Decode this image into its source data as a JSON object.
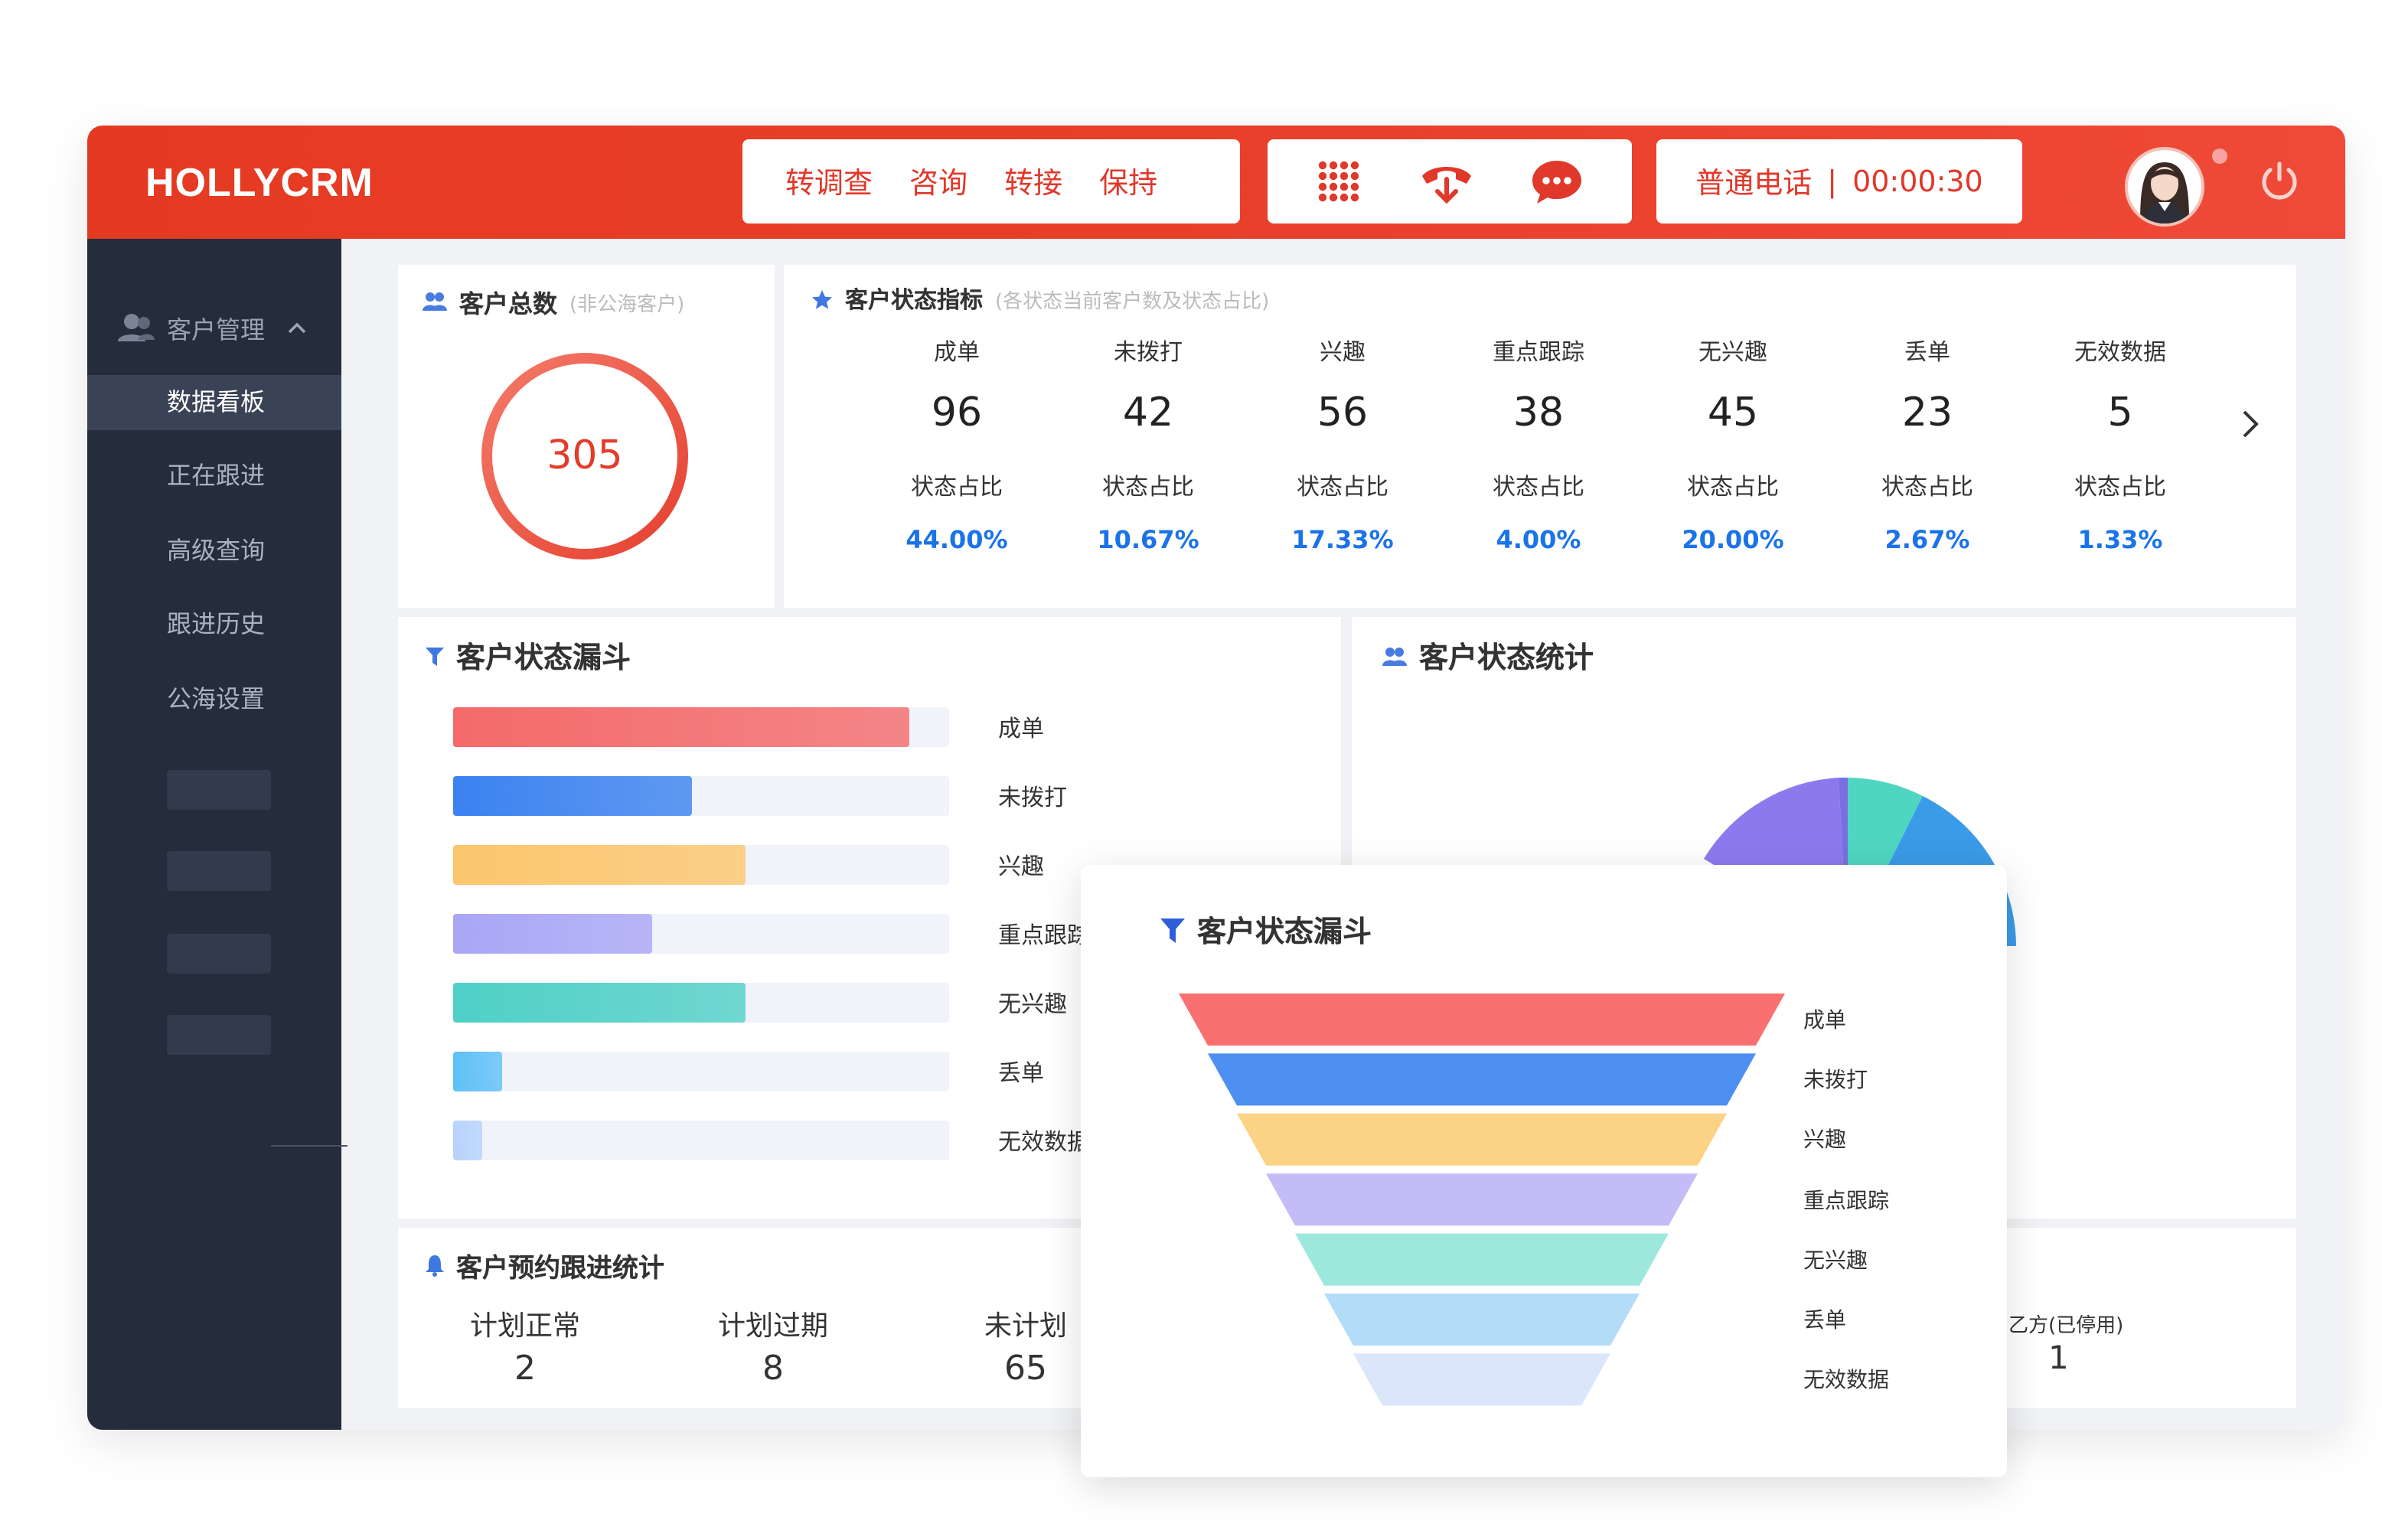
{
  "brand": "HOLLYCRM",
  "toolbar": {
    "actions": [
      "转调查",
      "咨询",
      "转接",
      "保持"
    ],
    "call_type": "普通电话",
    "separator": "|",
    "timer": "00:00:30",
    "icons": [
      "dialpad-icon",
      "hangup-icon",
      "chat-icon",
      "avatar",
      "power-icon"
    ]
  },
  "sidebar": {
    "group": "客户管理",
    "items": [
      "数据看板",
      "正在跟进",
      "高级查询",
      "跟进历史",
      "公海设置"
    ],
    "active": "数据看板"
  },
  "total_card": {
    "title": "客户总数",
    "subtitle": "(非公海客户)",
    "value": "305"
  },
  "status_card": {
    "title": "客户状态指标",
    "subtitle": "(各状态当前客户数及状态占比)",
    "ratio_label": "状态占比",
    "items": [
      {
        "label": "成单",
        "count": "96",
        "pct": "44.00%"
      },
      {
        "label": "未拨打",
        "count": "42",
        "pct": "10.67%"
      },
      {
        "label": "兴趣",
        "count": "56",
        "pct": "17.33%"
      },
      {
        "label": "重点跟踪",
        "count": "38",
        "pct": "4.00%"
      },
      {
        "label": "无兴趣",
        "count": "45",
        "pct": "20.00%"
      },
      {
        "label": "丢单",
        "count": "23",
        "pct": "2.67%"
      },
      {
        "label": "无效数据",
        "count": "5",
        "pct": "1.33%"
      }
    ]
  },
  "bar_card": {
    "title": "客户状态漏斗",
    "bars": [
      {
        "label": "成单",
        "fraction": 0.92,
        "color": "#f46a6a"
      },
      {
        "label": "未拨打",
        "fraction": 0.48,
        "color": "#3b82f0"
      },
      {
        "label": "兴趣",
        "fraction": 0.59,
        "color": "#fcc66c"
      },
      {
        "label": "重点跟踪",
        "fraction": 0.4,
        "color": "#a9a6f6"
      },
      {
        "label": "无兴趣",
        "fraction": 0.59,
        "color": "#4fd0c6"
      },
      {
        "label": "丢单",
        "fraction": 0.1,
        "color": "#5ec0f7"
      },
      {
        "label": "无效数据",
        "fraction": 0.06,
        "color": "#b7d2fb"
      }
    ]
  },
  "pie_card": {
    "title": "客户状态统计"
  },
  "appointment_card": {
    "title": "客户预约跟进统计",
    "items": [
      {
        "label": "计划正常",
        "value": "2"
      },
      {
        "label": "计划过期",
        "value": "8"
      },
      {
        "label": "未计划",
        "value": "65"
      }
    ],
    "partial_label": "乙方(已停用)",
    "partial_value": "1"
  },
  "funnel_popup": {
    "title": "客户状态漏斗",
    "labels": [
      "成单",
      "未拨打",
      "兴趣",
      "重点跟踪",
      "无兴趣",
      "丢单",
      "无效数据"
    ],
    "colors": [
      "#fa7070",
      "#4d8ff0",
      "#fcd284",
      "#c4bcf7",
      "#9ee7dc",
      "#b3dcf8",
      "#dbe6fb"
    ]
  }
}
